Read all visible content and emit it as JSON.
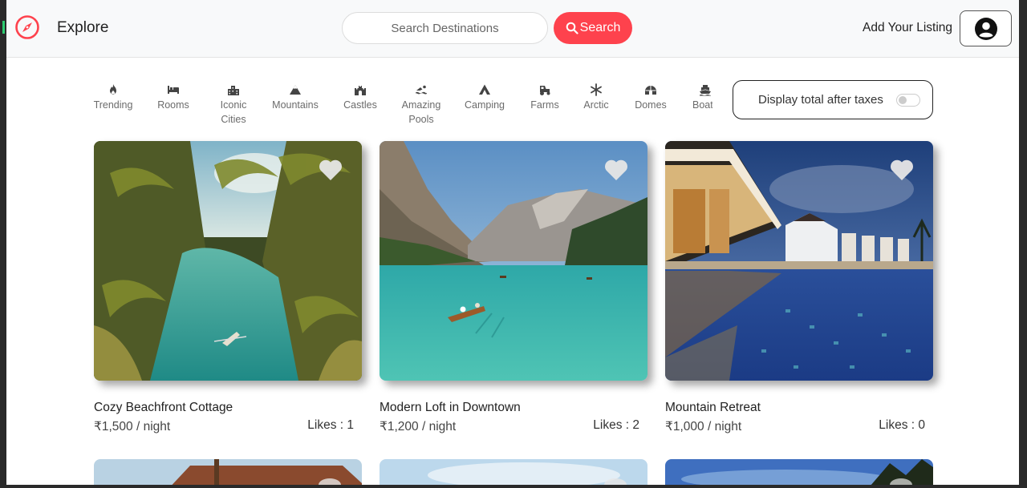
{
  "navbar": {
    "brand": "Explore",
    "search_placeholder": "Search Destinations",
    "search_button": "Search",
    "add_listing": "Add Your Listing"
  },
  "filters": [
    {
      "label": "Trending",
      "icon": "fire-icon"
    },
    {
      "label": "Rooms",
      "icon": "bed-icon"
    },
    {
      "label": "Iconic Cities",
      "icon": "city-icon"
    },
    {
      "label": "Mountains",
      "icon": "mountain-icon"
    },
    {
      "label": "Castles",
      "icon": "castle-icon"
    },
    {
      "label": "Amazing Pools",
      "icon": "swimmer-icon"
    },
    {
      "label": "Camping",
      "icon": "campground-icon"
    },
    {
      "label": "Farms",
      "icon": "tractor-icon"
    },
    {
      "label": "Arctic",
      "icon": "snowflake-icon"
    },
    {
      "label": "Domes",
      "icon": "igloo-icon"
    },
    {
      "label": "Boats",
      "icon": "ship-icon"
    }
  ],
  "tax_toggle": {
    "label": "Display total after taxes",
    "checked": false
  },
  "listings": [
    {
      "title": "Cozy Beachfront Cottage",
      "price": "₹1,500 / night",
      "likes": "Likes : 1"
    },
    {
      "title": "Modern Loft in Downtown",
      "price": "₹1,200 / night",
      "likes": "Likes : 2"
    },
    {
      "title": "Mountain Retreat",
      "price": "₹1,000 / night",
      "likes": "Likes : 0"
    }
  ],
  "colors": {
    "accent": "#fe424d",
    "heart": "#e6e6e6"
  }
}
